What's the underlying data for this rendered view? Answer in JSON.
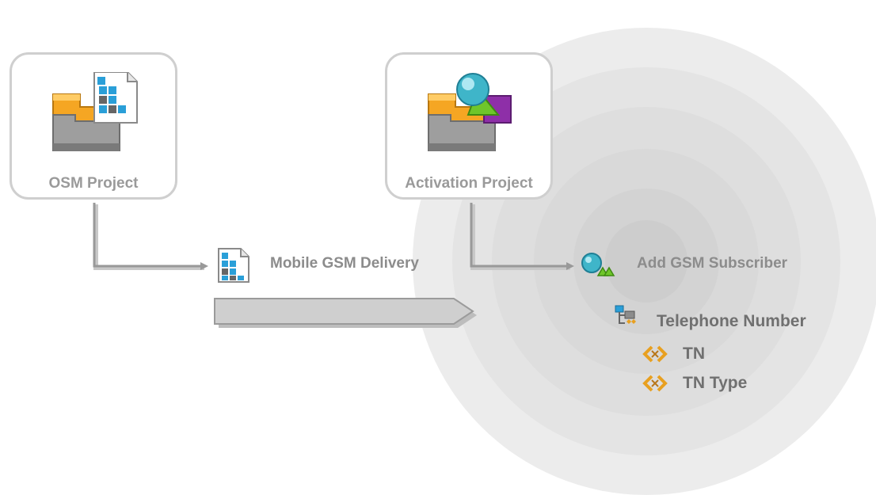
{
  "cards": {
    "osm": {
      "label": "OSM Project",
      "icon": "osm-project-icon"
    },
    "activation": {
      "label": "Activation Project",
      "icon": "activation-project-icon"
    }
  },
  "items": {
    "mobile_gsm_delivery": {
      "label": "Mobile GSM Delivery",
      "icon": "order-document-icon"
    },
    "add_gsm_subscriber": {
      "label": "Add GSM Subscriber",
      "icon": "service-action-icon"
    },
    "telephone_number": {
      "label": "Telephone Number",
      "icon": "structure-icon"
    },
    "tn": {
      "label": "TN",
      "icon": "data-element-icon"
    },
    "tn_type": {
      "label": "TN Type",
      "icon": "data-element-icon"
    }
  },
  "colors": {
    "card_border": "#cfcfcf",
    "circle_outer": "#ececec",
    "circle_inner": "#d6d6d6",
    "connector": "#999999",
    "folder_orange": "#f5a623",
    "element_orange": "#e8a020"
  }
}
